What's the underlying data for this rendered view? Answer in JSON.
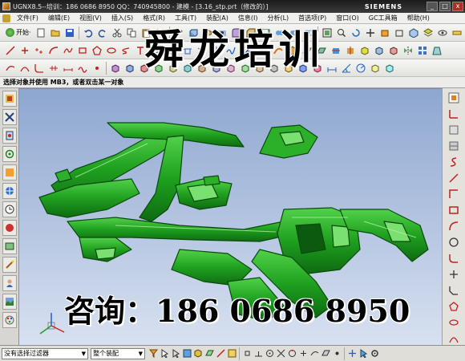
{
  "titlebar": {
    "title": "UGNX8.5--培训：186 0686 8950 QQ：740945800 - 建模 - [3.16_stp.prt（修改的）]",
    "brand": "SIEMENS",
    "minimize": "_",
    "maximize": "□",
    "close": "x"
  },
  "menubar": {
    "items": [
      "文件(F)",
      "编辑(E)",
      "视图(V)",
      "插入(S)",
      "格式(R)",
      "工具(T)",
      "装配(A)",
      "信息(I)",
      "分析(L)",
      "首选项(P)",
      "窗口(O)",
      "GC工具箱",
      "帮助(H)"
    ]
  },
  "toolbar": {
    "start_label": "开始·"
  },
  "cue_line": "选择对象并使用 MB3，或者双击某一对象",
  "watermark": {
    "top": "舜龙培训",
    "bottom": "咨询：186 0686 8950"
  },
  "statusbar": {
    "filter_value": "没有选择过滤器",
    "scope_value": "整个装配"
  },
  "colors": {
    "model_green": "#1fa01f",
    "background_top": "#8ea7d0",
    "background_bottom": "#d8e1f0"
  }
}
